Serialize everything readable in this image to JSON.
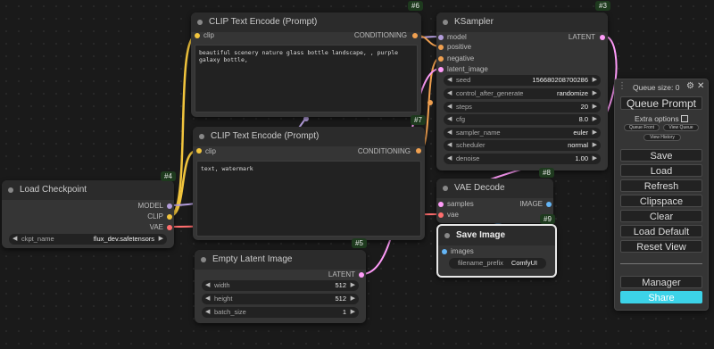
{
  "nodes": {
    "clip_top": {
      "title": "CLIP Text Encode (Prompt)",
      "badge": "#6",
      "input": "clip",
      "output": "CONDITIONING",
      "text": "beautiful scenery nature glass bottle landscape, , purple galaxy bottle,"
    },
    "clip_bottom": {
      "title": "CLIP Text Encode (Prompt)",
      "badge": "#7",
      "input": "clip",
      "output": "CONDITIONING",
      "text": "text, watermark"
    },
    "ksampler": {
      "title": "KSampler",
      "badge": "#3",
      "inputs": [
        "model",
        "positive",
        "negative",
        "latent_image"
      ],
      "output": "LATENT",
      "widgets": [
        {
          "label": "seed",
          "value": "156680208700286"
        },
        {
          "label": "control_after_generate",
          "value": "randomize"
        },
        {
          "label": "steps",
          "value": "20"
        },
        {
          "label": "cfg",
          "value": "8.0"
        },
        {
          "label": "sampler_name",
          "value": "euler"
        },
        {
          "label": "scheduler",
          "value": "normal"
        },
        {
          "label": "denoise",
          "value": "1.00"
        }
      ]
    },
    "checkpoint": {
      "title": "Load Checkpoint",
      "badge": "#4",
      "outputs": [
        "MODEL",
        "CLIP",
        "VAE"
      ],
      "widget": {
        "label": "ckpt_name",
        "value": "flux_dev.safetensors"
      }
    },
    "vae_decode": {
      "title": "VAE Decode",
      "badge": "#8",
      "inputs": [
        "samples",
        "vae"
      ],
      "output": "IMAGE"
    },
    "save_image": {
      "title": "Save Image",
      "badge": "#9",
      "input": "images",
      "widget": {
        "label": "filename_prefix",
        "value": "ComfyUI"
      }
    },
    "empty_latent": {
      "title": "Empty Latent Image",
      "badge": "#5",
      "output": "LATENT",
      "widgets": [
        {
          "label": "width",
          "value": "512"
        },
        {
          "label": "height",
          "value": "512"
        },
        {
          "label": "batch_size",
          "value": "1"
        }
      ]
    }
  },
  "menu": {
    "queue_size": "Queue size: 0",
    "queue_prompt": "Queue Prompt",
    "extra_options": "Extra options",
    "queue_front": "Queue Front",
    "view_queue": "View Queue",
    "view_history": "View History",
    "save": "Save",
    "load": "Load",
    "refresh": "Refresh",
    "clipspace": "Clipspace",
    "clear": "Clear",
    "load_default": "Load Default",
    "reset_view": "Reset View",
    "manager": "Manager",
    "share": "Share"
  },
  "colors": {
    "clip_wire": "#f2c53d",
    "model_wire": "#b39ddb",
    "cond_wire": "#f0a050",
    "latent_wire": "#ff9cf9",
    "vae_wire": "#ff6e6e",
    "image_wire": "#64b5f6",
    "share": "#3cd3e8"
  }
}
